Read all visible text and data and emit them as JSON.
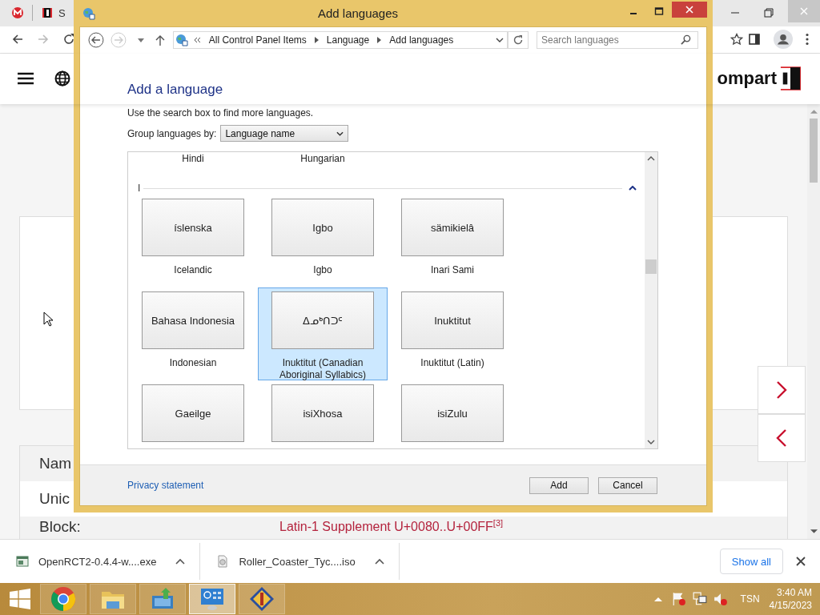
{
  "browser": {
    "tab_title": "S",
    "logo_text": "ompart",
    "rows": [
      {
        "label": "Nam"
      },
      {
        "label": "Unic"
      },
      {
        "label": "Block:",
        "value": "Latin-1 Supplement U+0080..U+00FF$^{[3]}$"
      }
    ]
  },
  "dialog": {
    "title": "Add languages",
    "breadcrumb": [
      "All Control Panel Items",
      "Language",
      "Add languages"
    ],
    "search": {
      "placeholder": "Search languages"
    },
    "heading": "Add a language",
    "hint": "Use the search box to find more languages.",
    "group_by": {
      "label": "Group languages by:",
      "value": "Language name"
    },
    "top_labels": [
      "Hindi",
      "Hungarian"
    ],
    "group": {
      "letter": "I",
      "expanded": true,
      "languages": [
        {
          "native": "íslenska",
          "name": "Icelandic",
          "selected": false
        },
        {
          "native": "Igbo",
          "name": "Igbo",
          "selected": false
        },
        {
          "native": "sämikielâ",
          "name": "Inari Sami",
          "selected": false
        },
        {
          "native": "Bahasa Indonesia",
          "name": "Indonesian",
          "selected": false
        },
        {
          "native": "ᐃᓄᒃᑎᑐᑦ",
          "name": "Inuktitut (Canadian Aboriginal Syllabics)",
          "selected": true
        },
        {
          "native": "Inuktitut",
          "name": "Inuktitut (Latin)",
          "selected": false
        },
        {
          "native": "Gaeilge",
          "selected": false
        },
        {
          "native": "isiXhosa",
          "selected": false
        },
        {
          "native": "isiZulu",
          "selected": false
        }
      ]
    },
    "privacy_link": "Privacy statement",
    "buttons": [
      "Add",
      "Cancel"
    ]
  },
  "downloads": {
    "items": [
      {
        "kind": "exe",
        "name": "OpenRCT2-0.4.4-w....exe"
      },
      {
        "kind": "iso",
        "name": "Roller_Coaster_Tyc....iso"
      }
    ],
    "show_all": "Show all"
  },
  "taskbar": {
    "apps": [
      {
        "kind": "chrome",
        "selected": false
      },
      {
        "kind": "folder",
        "selected": false
      },
      {
        "kind": "installer",
        "selected": false
      },
      {
        "kind": "control-panel",
        "selected": true
      },
      {
        "kind": "game",
        "selected": false
      }
    ],
    "language": "TSN",
    "time": "3:40 AM",
    "date": "4/15/2023"
  }
}
